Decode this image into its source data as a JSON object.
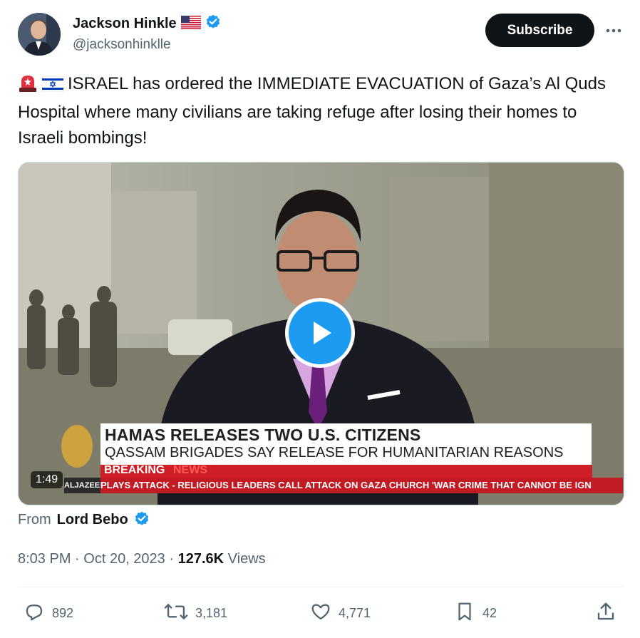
{
  "author": {
    "name": "Jackson Hinkle",
    "handle": "@jacksonhinklle",
    "flag_icon": "us-flag-icon",
    "verified_icon": "verified-badge-icon"
  },
  "header": {
    "subscribe_label": "Subscribe",
    "more_icon": "more-horizontal-icon"
  },
  "tweet": {
    "emojis": [
      "rotating-light-icon",
      "israel-flag-icon"
    ],
    "text": "ISRAEL has ordered the IMMEDIATE EVACUATION of Gaza’s Al Quds Hospital where many civilians are taking refuge after losing their homes to Israeli bombings!"
  },
  "media": {
    "duration": "1:49",
    "headline": "HAMAS RELEASES TWO U.S. CITIZENS",
    "subheadline": "QASSAM BRIGADES SAY RELEASE FOR HUMANITARIAN REASONS",
    "breaking": "BREAKING",
    "news": "NEWS",
    "ticker_logo": "ALJAZEERA",
    "ticker": "PLAYS ATTACK   -   RELIGIOUS LEADERS CALL ATTACK ON GAZA CHURCH 'WAR CRIME THAT CANNOT BE IGN",
    "play_icon": "play-icon"
  },
  "attribution": {
    "from_label": "From",
    "source_name": "Lord Bebo"
  },
  "meta": {
    "time": "8:03 PM",
    "sep1": "·",
    "date": "Oct 20, 2023",
    "sep2": "·",
    "views_count": "127.6K",
    "views_label": "Views"
  },
  "actions": {
    "replies": "892",
    "reposts": "3,181",
    "likes": "4,771",
    "bookmarks": "42"
  },
  "colors": {
    "accent": "#1d9bf0",
    "text": "#0f1419",
    "secondary": "#536471",
    "button_dark": "#0f1419"
  }
}
